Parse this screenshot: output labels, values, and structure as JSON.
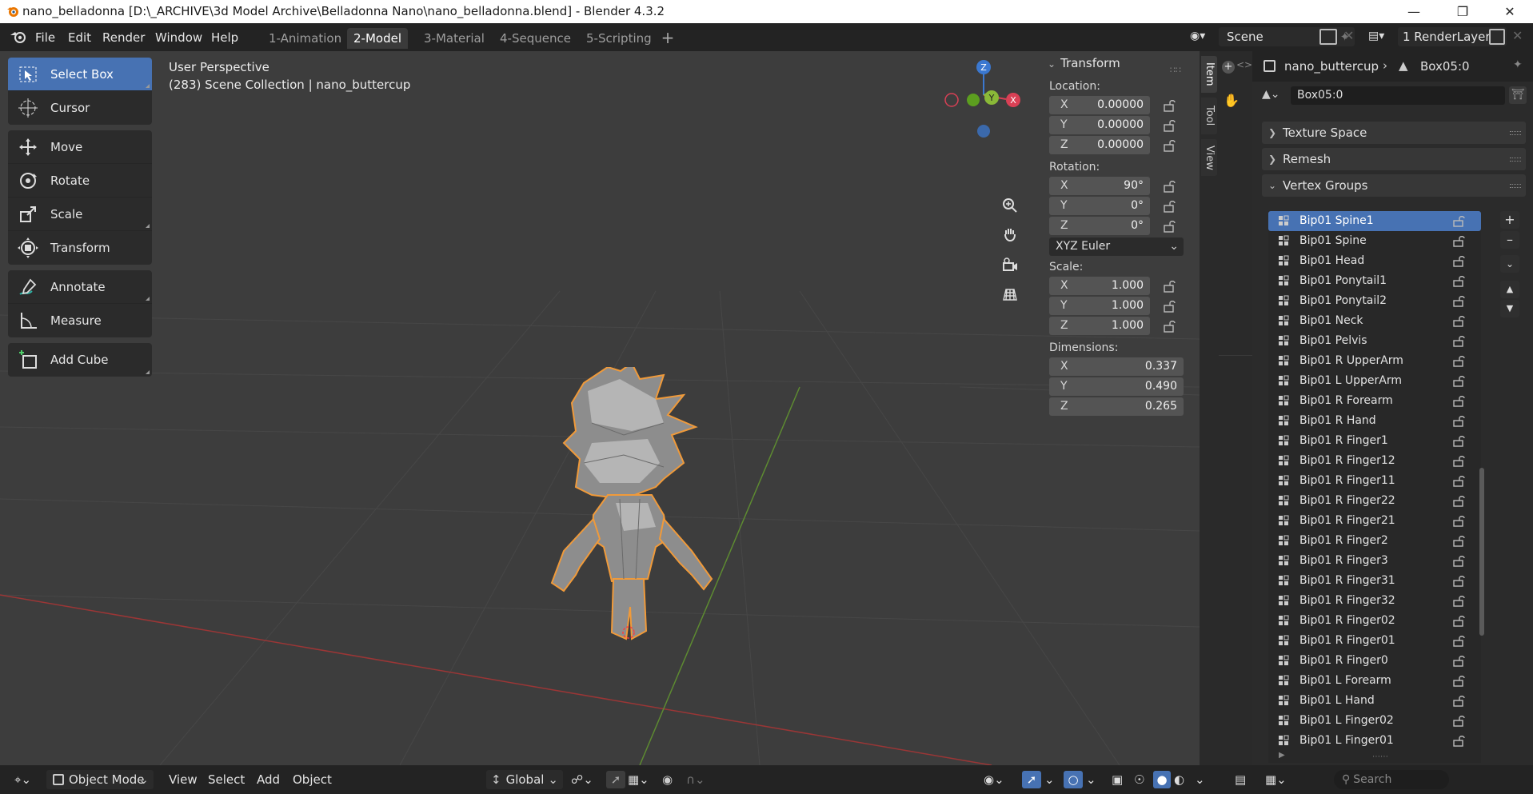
{
  "window": {
    "title": "nano_belladonna [D:\\_ARCHIVE\\3d Model Archive\\Belladonna Nano\\nano_belladonna.blend] - Blender 4.3.2",
    "minimize_icon": "minimize-icon",
    "maximize_icon": "restore-icon",
    "close_icon": "close-icon"
  },
  "menubar": {
    "items": [
      "File",
      "Edit",
      "Render",
      "Window",
      "Help"
    ],
    "workspaces": [
      "1-Animation",
      "2-Model",
      "3-Material",
      "4-Sequence",
      "5-Scripting"
    ],
    "active_workspace": "2-Model",
    "scene": "Scene",
    "view_layer": "1 RenderLayer"
  },
  "toolbar": {
    "tools": [
      {
        "label": "Select Box",
        "icon": "select-box-icon",
        "active": true
      },
      {
        "label": "Cursor",
        "icon": "cursor-icon"
      },
      {
        "label": "Move",
        "icon": "move-icon"
      },
      {
        "label": "Rotate",
        "icon": "rotate-icon"
      },
      {
        "label": "Scale",
        "icon": "scale-icon"
      },
      {
        "label": "Transform",
        "icon": "transform-icon"
      },
      {
        "label": "Annotate",
        "icon": "annotate-icon"
      },
      {
        "label": "Measure",
        "icon": "measure-icon"
      },
      {
        "label": "Add Cube",
        "icon": "add-cube-icon"
      }
    ]
  },
  "viewport": {
    "view_name": "User Perspective",
    "collection_info": "(283) Scene Collection | nano_buttercup",
    "gizmo_axes": [
      "Z",
      "Y",
      "X"
    ]
  },
  "npanel": {
    "header": "Transform",
    "location_label": "Location:",
    "location": [
      {
        "axis": "X",
        "value": "0.00000"
      },
      {
        "axis": "Y",
        "value": "0.00000"
      },
      {
        "axis": "Z",
        "value": "0.00000"
      }
    ],
    "rotation_label": "Rotation:",
    "rotation": [
      {
        "axis": "X",
        "value": "90°"
      },
      {
        "axis": "Y",
        "value": "0°"
      },
      {
        "axis": "Z",
        "value": "0°"
      }
    ],
    "rotation_mode": "XYZ Euler",
    "scale_label": "Scale:",
    "scale": [
      {
        "axis": "X",
        "value": "1.000"
      },
      {
        "axis": "Y",
        "value": "1.000"
      },
      {
        "axis": "Z",
        "value": "1.000"
      }
    ],
    "dimensions_label": "Dimensions:",
    "dimensions": [
      {
        "axis": "X",
        "value": "0.337"
      },
      {
        "axis": "Y",
        "value": "0.490"
      },
      {
        "axis": "Z",
        "value": "0.265"
      }
    ],
    "tabs": [
      "Item",
      "Tool",
      "View"
    ]
  },
  "properties": {
    "object_name": "nano_buttercup",
    "mesh_name": "Box05:0",
    "data_field": "Box05:0",
    "panels": [
      "Texture Space",
      "Remesh",
      "Vertex Groups"
    ],
    "vertex_groups": [
      "Bip01 Spine1",
      "Bip01 Spine",
      "Bip01 Head",
      "Bip01 Ponytail1",
      "Bip01 Ponytail2",
      "Bip01 Neck",
      "Bip01 Pelvis",
      "Bip01 R UpperArm",
      "Bip01 L UpperArm",
      "Bip01 R Forearm",
      "Bip01 R Hand",
      "Bip01 R Finger1",
      "Bip01 R Finger12",
      "Bip01 R Finger11",
      "Bip01 R Finger22",
      "Bip01 R Finger21",
      "Bip01 R Finger2",
      "Bip01 R Finger3",
      "Bip01 R Finger31",
      "Bip01 R Finger32",
      "Bip01 R Finger02",
      "Bip01 R Finger01",
      "Bip01 R Finger0",
      "Bip01 L Forearm",
      "Bip01 L Hand",
      "Bip01 L Finger02",
      "Bip01 L Finger01"
    ],
    "selected_group": "Bip01 Spine1"
  },
  "bottombar": {
    "mode": "Object Mode",
    "menus": [
      "View",
      "Select",
      "Add",
      "Object"
    ],
    "orientation": "Global",
    "search_placeholder": "Search"
  }
}
